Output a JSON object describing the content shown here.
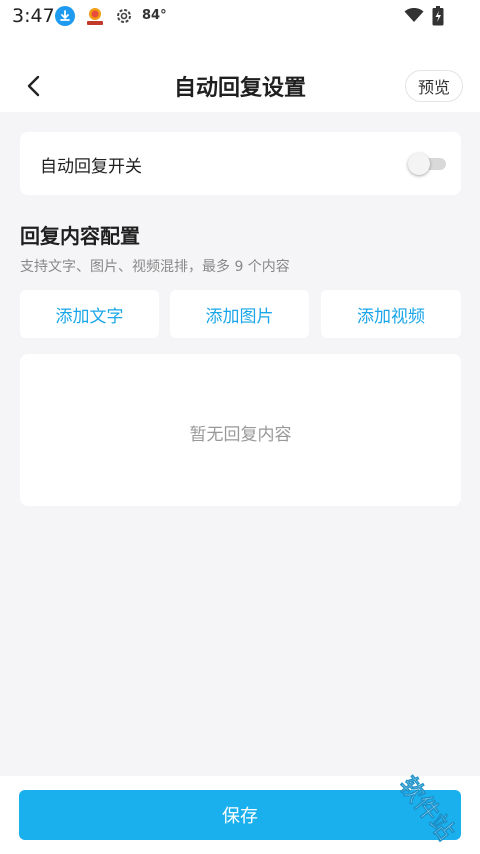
{
  "status_bar": {
    "time": "3:47",
    "temperature": "84°",
    "icons": [
      "download-icon",
      "app-badge-icon",
      "settings-icon",
      "wifi-icon",
      "battery-icon"
    ]
  },
  "header": {
    "title": "自动回复设置",
    "preview_label": "预览",
    "back_icon": "chevron-left-icon"
  },
  "auto_reply_switch": {
    "label": "自动回复开关",
    "enabled": false
  },
  "reply_content": {
    "title": "回复内容配置",
    "subtitle": "支持文字、图片、视频混排，最多 9 个内容",
    "buttons": {
      "add_text": "添加文字",
      "add_image": "添加图片",
      "add_video": "添加视频"
    },
    "empty_text": "暂无回复内容"
  },
  "footer": {
    "save_label": "保存"
  },
  "watermark": {
    "text": "软件站"
  },
  "colors": {
    "accent": "#1ab0ee",
    "link": "#1aa6e8",
    "background": "#f5f5f7",
    "card": "#ffffff"
  }
}
